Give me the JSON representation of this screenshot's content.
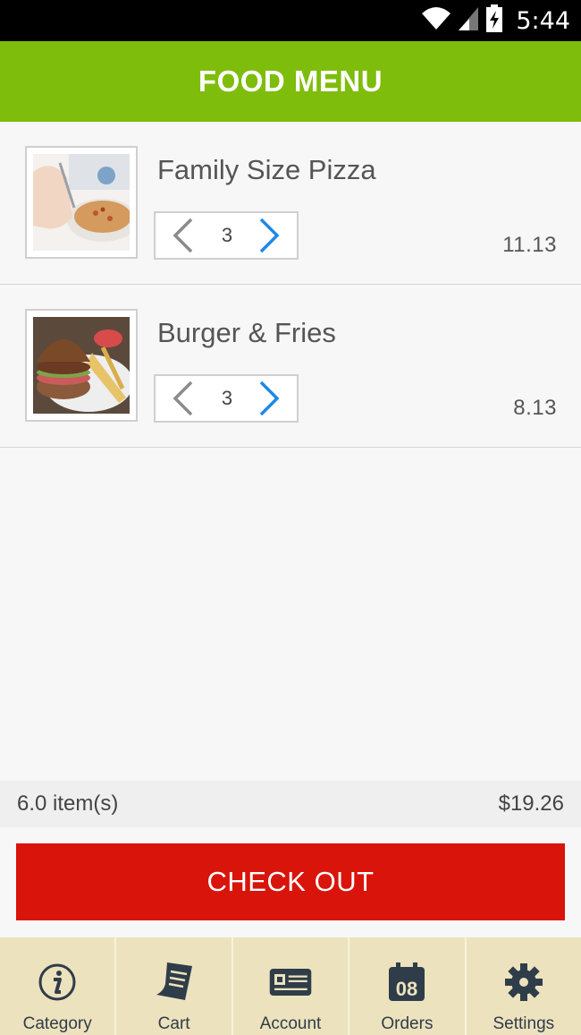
{
  "status_bar": {
    "time": "5:44",
    "wifi_icon": "wifi-icon",
    "signal_icon": "signal-icon",
    "battery_icon": "battery-charging-icon"
  },
  "app_bar": {
    "title": "FOOD MENU"
  },
  "items": [
    {
      "name": "Family Size Pizza",
      "quantity": "3",
      "price": "11.13",
      "image": "pizza-photo"
    },
    {
      "name": "Burger & Fries",
      "quantity": "3",
      "price": "8.13",
      "image": "burger-photo"
    }
  ],
  "summary": {
    "count": "6.0  item(s)",
    "total": "$19.26"
  },
  "checkout": {
    "label": "CHECK OUT"
  },
  "tabs": [
    {
      "label": "Category",
      "icon": "info-icon"
    },
    {
      "label": "Cart",
      "icon": "receipt-icon"
    },
    {
      "label": "Account",
      "icon": "id-card-icon"
    },
    {
      "label": "Orders",
      "icon": "calendar-icon",
      "icon_text": "08"
    },
    {
      "label": "Settings",
      "icon": "gear-icon"
    }
  ],
  "colors": {
    "app_bar": "#7ebd0b",
    "checkout": "#d9140a",
    "tab_bar": "#ece2bd",
    "stepper_next": "#1e88e5",
    "stepper_prev": "#8a8a8a"
  }
}
